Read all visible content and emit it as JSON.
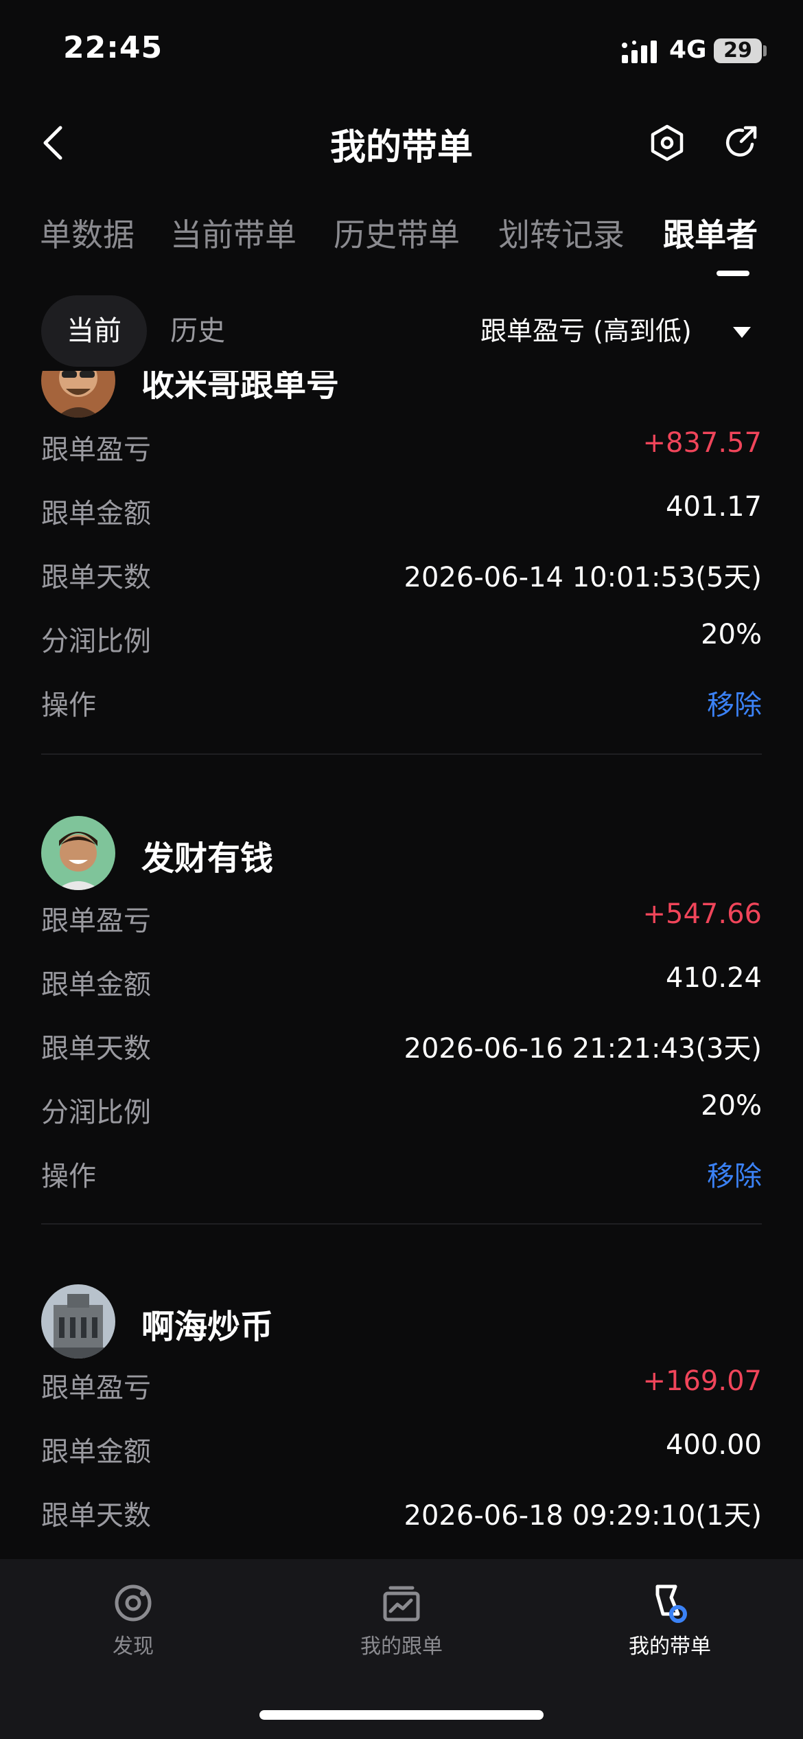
{
  "status": {
    "time": "22:45",
    "network": "4G",
    "battery": "29"
  },
  "header": {
    "title": "我的带单"
  },
  "tabs": [
    {
      "label": "单数据"
    },
    {
      "label": "当前带单"
    },
    {
      "label": "历史带单"
    },
    {
      "label": "划转记录"
    },
    {
      "label": "跟单者",
      "active": true
    }
  ],
  "segment": {
    "current": "当前",
    "history": "历史"
  },
  "sort": {
    "label": "跟单盈亏 (高到低)"
  },
  "followers": [
    {
      "name": "收米哥跟单号",
      "pnl_label": "跟单盈亏",
      "pnl": "+837.57",
      "amount_label": "跟单金额",
      "amount": "401.17",
      "days_label": "跟单天数",
      "days": "2026-06-14 10:01:53(5天)",
      "share_label": "分润比例",
      "share": "20%",
      "op_label": "操作",
      "op": "移除"
    },
    {
      "name": "发财有钱",
      "pnl_label": "跟单盈亏",
      "pnl": "+547.66",
      "amount_label": "跟单金额",
      "amount": "410.24",
      "days_label": "跟单天数",
      "days": "2026-06-16 21:21:43(3天)",
      "share_label": "分润比例",
      "share": "20%",
      "op_label": "操作",
      "op": "移除"
    },
    {
      "name": "啊海炒币",
      "pnl_label": "跟单盈亏",
      "pnl": "+169.07",
      "amount_label": "跟单金额",
      "amount": "400.00",
      "days_label": "跟单天数",
      "days": "2026-06-18 09:29:10(1天)"
    }
  ],
  "tabbar": [
    {
      "label": "发现",
      "icon": "discover-icon"
    },
    {
      "label": "我的跟单",
      "icon": "chart-icon"
    },
    {
      "label": "我的带单",
      "icon": "flag-icon",
      "active": true
    }
  ],
  "colors": {
    "background": "#0b0b0c",
    "profit": "#f0455a",
    "link": "#3b82f6",
    "tabbar": "#17171a"
  }
}
